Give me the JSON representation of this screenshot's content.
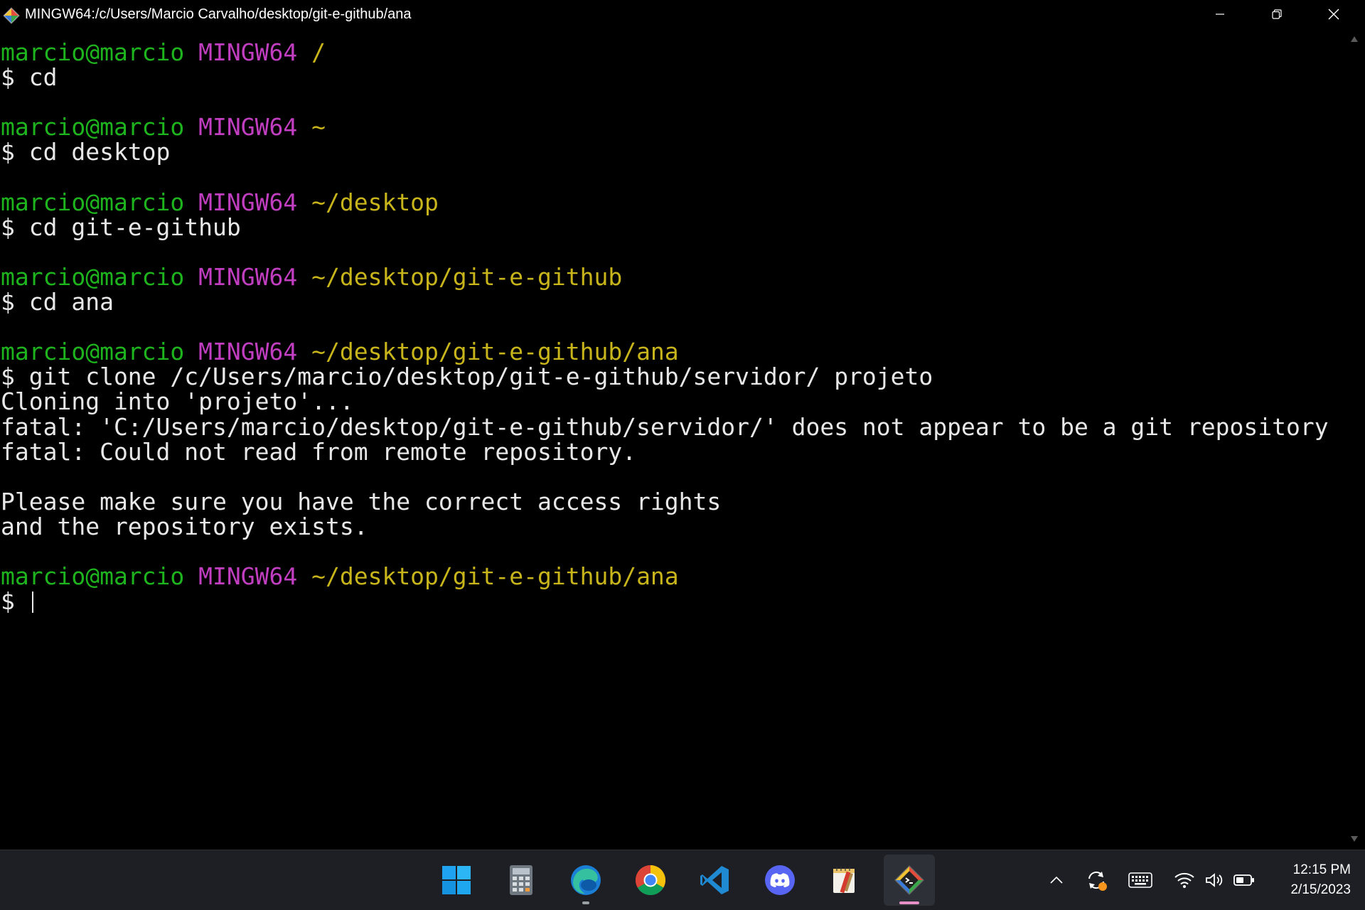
{
  "window": {
    "title": "MINGW64:/c/Users/Marcio Carvalho/desktop/git-e-github/ana"
  },
  "terminal": {
    "lines": [
      {
        "user": "marcio@marcio",
        "host": "MINGW64",
        "path": "/"
      },
      {
        "text": "$ cd"
      },
      {
        "text": ""
      },
      {
        "user": "marcio@marcio",
        "host": "MINGW64",
        "path": "~"
      },
      {
        "text": "$ cd desktop"
      },
      {
        "text": ""
      },
      {
        "user": "marcio@marcio",
        "host": "MINGW64",
        "path": "~/desktop"
      },
      {
        "text": "$ cd git-e-github"
      },
      {
        "text": ""
      },
      {
        "user": "marcio@marcio",
        "host": "MINGW64",
        "path": "~/desktop/git-e-github"
      },
      {
        "text": "$ cd ana"
      },
      {
        "text": ""
      },
      {
        "user": "marcio@marcio",
        "host": "MINGW64",
        "path": "~/desktop/git-e-github/ana"
      },
      {
        "text": "$ git clone /c/Users/marcio/desktop/git-e-github/servidor/ projeto"
      },
      {
        "text": "Cloning into 'projeto'..."
      },
      {
        "text": "fatal: 'C:/Users/marcio/desktop/git-e-github/servidor/' does not appear to be a git repository"
      },
      {
        "text": "fatal: Could not read from remote repository."
      },
      {
        "text": ""
      },
      {
        "text": "Please make sure you have the correct access rights"
      },
      {
        "text": "and the repository exists."
      },
      {
        "text": ""
      },
      {
        "user": "marcio@marcio",
        "host": "MINGW64",
        "path": "~/desktop/git-e-github/ana"
      },
      {
        "text": "$ ",
        "cursor": true
      }
    ]
  },
  "taskbar": {
    "apps": [
      {
        "name": "start",
        "icon": "windows-start-icon",
        "active": false,
        "running": false
      },
      {
        "name": "calculator",
        "icon": "calculator-icon",
        "active": false,
        "running": false
      },
      {
        "name": "edge",
        "icon": "edge-icon",
        "active": false,
        "running": true
      },
      {
        "name": "chrome",
        "icon": "chrome-icon",
        "active": false,
        "running": false
      },
      {
        "name": "vscode",
        "icon": "vscode-icon",
        "active": false,
        "running": false
      },
      {
        "name": "discord",
        "icon": "discord-icon",
        "active": false,
        "running": false
      },
      {
        "name": "notes",
        "icon": "notebook-icon",
        "active": false,
        "running": false
      },
      {
        "name": "git-bash",
        "icon": "git-bash-icon",
        "active": true,
        "running": true
      }
    ],
    "tray": [
      "chevron-up-icon",
      "sync-icon",
      "keyboard-icon",
      "wifi-icon",
      "volume-icon",
      "battery-icon"
    ],
    "clock": {
      "time": "12:15 PM",
      "date": "2/15/2023"
    }
  },
  "colors": {
    "prompt_user": "#1db41d",
    "prompt_host": "#c13ec1",
    "prompt_path": "#c8b41b",
    "text": "#e8e8e8",
    "background": "#000000",
    "taskbar": "#1d1f24",
    "active_indicator": "#e88fc7"
  }
}
